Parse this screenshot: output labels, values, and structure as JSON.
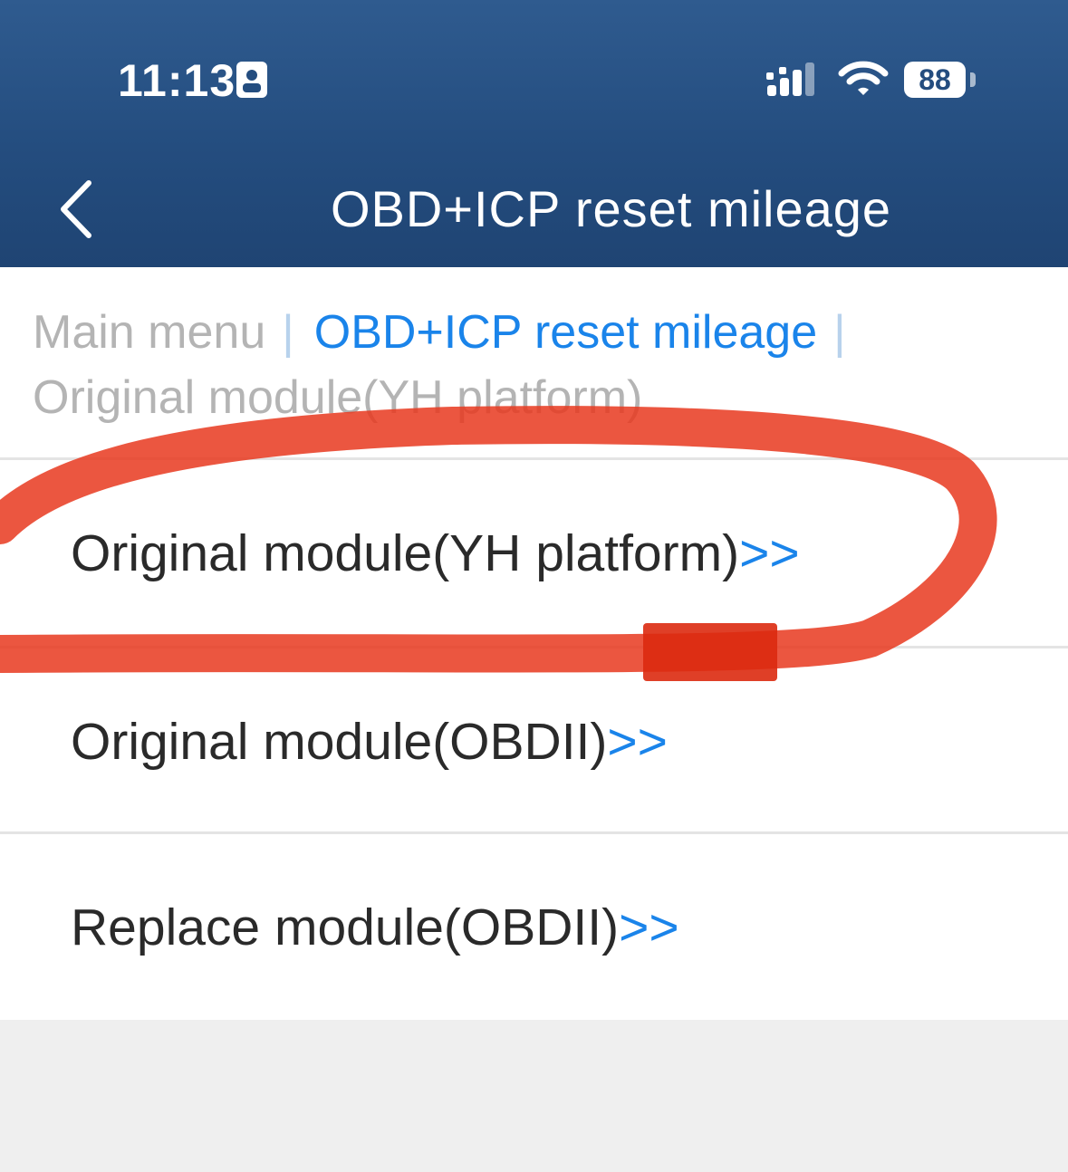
{
  "status_bar": {
    "time": "11:13",
    "battery": "88",
    "icons": [
      "person-badge-icon",
      "cellular-signal-icon",
      "wifi-icon",
      "battery-icon"
    ]
  },
  "header": {
    "title": "OBD+ICP reset mileage",
    "back_icon": "chevron-left-icon"
  },
  "breadcrumb": {
    "items": [
      "Main menu",
      "OBD+ICP reset mileage",
      "Original module(YH platform)"
    ],
    "separator": "|"
  },
  "menu": {
    "items": [
      {
        "label": "Original module(YH platform)",
        "arrow": ">>"
      },
      {
        "label": "Original module(OBDII)",
        "arrow": ">>"
      },
      {
        "label": "Replace module(OBDII)",
        "arrow": ">>"
      }
    ]
  },
  "colors": {
    "header": "#244d7f",
    "accent": "#1a84ea",
    "annotation": "#e8381e"
  }
}
